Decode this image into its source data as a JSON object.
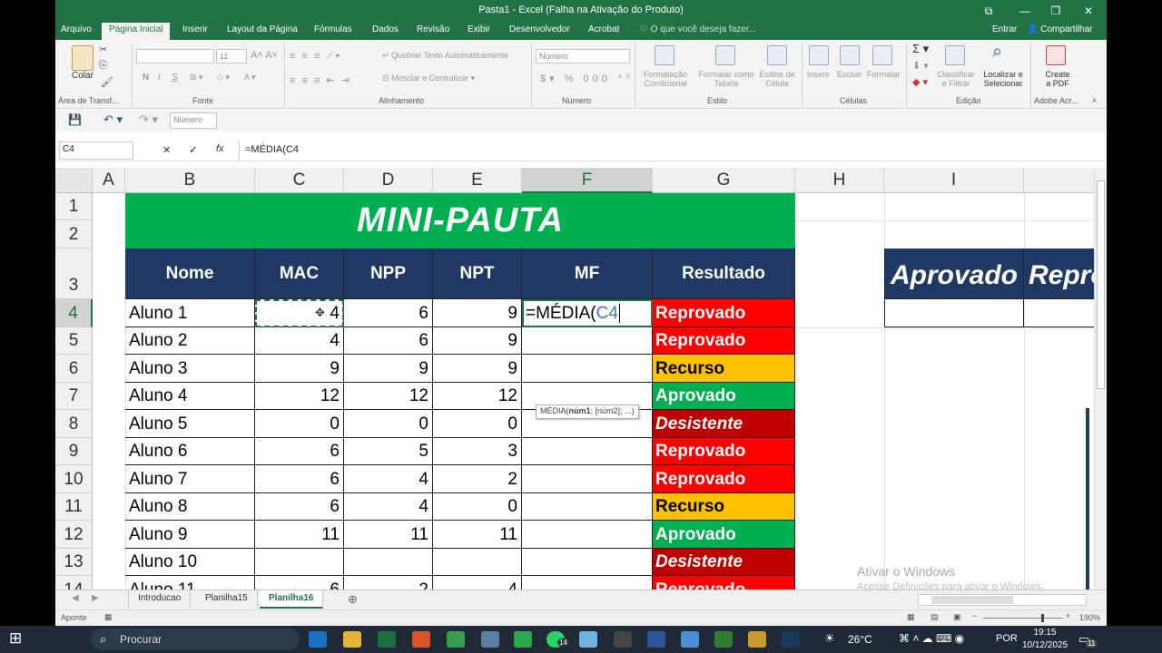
{
  "window": {
    "title": "Pasta1 - Excel (Falha na Ativação do Produto)",
    "restore": "⧉",
    "minimize": "—",
    "maximize": "❐",
    "close": "✕"
  },
  "tabs": [
    "Arquivo",
    "Página Inicial",
    "Inserir",
    "Layout da Página",
    "Fórmulas",
    "Dados",
    "Revisão",
    "Exibir",
    "Desenvolvedor",
    "Acrobat"
  ],
  "search_placeholder": "O que você deseja fazer...",
  "account": {
    "signin": "Entrar",
    "share": "Compartilhar"
  },
  "ribbon": {
    "clipboard": {
      "paste": "Colar",
      "group": "Área de Transf..."
    },
    "font": {
      "group": "Fonte",
      "size": "11",
      "bold": "N",
      "italic": "I",
      "underline": "S"
    },
    "alignment": {
      "group": "Alinhamento",
      "wrap": "Quebrar Texto Automaticamente",
      "merge": "Mesclar e Centralizar"
    },
    "number": {
      "group": "Número",
      "format": "Número"
    },
    "styles": {
      "group": "Estilo",
      "cond_fmt": "Formatação",
      "cond_fmt2": "Condicional",
      "table_fmt": "Formatar como",
      "table_fmt2": "Tabela",
      "cell_styles": "Estilos de",
      "cell_styles2": "Célula"
    },
    "cells": {
      "group": "Células",
      "insert": "Inserir",
      "delete": "Excluir",
      "format": "Formatar"
    },
    "editing": {
      "group": "Edição",
      "sort": "Classificar",
      "sort2": "e Filtrar",
      "find": "Localizar e",
      "find2": "Selecionar"
    },
    "acrobat": {
      "group": "Adobe Acr...",
      "create": "Create",
      "create2": "a PDF"
    }
  },
  "qat": {
    "number_format": "Número"
  },
  "formula_bar": {
    "name_box": "C4",
    "cancel": "✕",
    "enter": "✓",
    "fx": "fx",
    "formula": "=MÉDIA(C4"
  },
  "columns": [
    "A",
    "B",
    "C",
    "D",
    "E",
    "F",
    "G",
    "H",
    "I"
  ],
  "rows": [
    "1",
    "2",
    "3",
    "4",
    "5",
    "6",
    "7",
    "8",
    "9",
    "10",
    "11",
    "12",
    "13",
    "14"
  ],
  "sheet": {
    "title": "MINI-PAUTA",
    "headers": [
      "Nome",
      "MAC",
      "NPP",
      "NPT",
      "MF",
      "Resultado"
    ],
    "students": [
      {
        "name": "Aluno 1",
        "mac": "4",
        "npp": "6",
        "npt": "9",
        "mf": "=MÉDIA(",
        "mf_ref": "C4",
        "result": "Reprovado"
      },
      {
        "name": "Aluno 2",
        "mac": "4",
        "npp": "6",
        "npt": "9",
        "mf": "",
        "result": "Reprovado"
      },
      {
        "name": "Aluno 3",
        "mac": "9",
        "npp": "9",
        "npt": "9",
        "mf": "",
        "result": "Recurso"
      },
      {
        "name": "Aluno 4",
        "mac": "12",
        "npp": "12",
        "npt": "12",
        "mf": "",
        "result": "Aprovado"
      },
      {
        "name": "Aluno 5",
        "mac": "0",
        "npp": "0",
        "npt": "0",
        "mf": "",
        "result": "Desistente"
      },
      {
        "name": "Aluno 6",
        "mac": "6",
        "npp": "5",
        "npt": "3",
        "mf": "",
        "result": "Reprovado"
      },
      {
        "name": "Aluno 7",
        "mac": "6",
        "npp": "4",
        "npt": "2",
        "mf": "",
        "result": "Reprovado"
      },
      {
        "name": "Aluno 8",
        "mac": "6",
        "npp": "4",
        "npt": "0",
        "mf": "",
        "result": "Recurso"
      },
      {
        "name": "Aluno 9",
        "mac": "11",
        "npp": "11",
        "npt": "11",
        "mf": "",
        "result": "Aprovado"
      },
      {
        "name": "Aluno 10",
        "mac": "",
        "npp": "",
        "npt": "",
        "mf": "",
        "result": "Desistente"
      },
      {
        "name": "Aluno 11",
        "mac": "6",
        "npp": "2",
        "npt": "4",
        "mf": "",
        "result": "Reprovado"
      }
    ],
    "side_headers": [
      "Aprovado",
      "Repro"
    ],
    "tooltip_fn": "MÉDIA(",
    "tooltip_arg1": "núm1",
    "tooltip_rest": "; [núm2]; ...)"
  },
  "result_colors": {
    "Reprovado": "#ff0000",
    "Recurso": "#ffc000",
    "Aprovado": "#00b050",
    "Desistente": "#c00000"
  },
  "sheet_tabs": [
    "Introducao",
    "Planilha15",
    "Planilha16"
  ],
  "active_sheet": "Planilha16",
  "status": {
    "mode": "Aponte",
    "zoom": "190%"
  },
  "watermark": {
    "line1": "Ativar o Windows",
    "line2": "Acesse Definições para ativar o Windows."
  },
  "taskbar": {
    "search": "Procurar",
    "weather": "26°C",
    "lang": "POR",
    "time": "19:15",
    "date": "10/12/2025",
    "whatsapp_badge": "14",
    "notif_badge": "11"
  }
}
